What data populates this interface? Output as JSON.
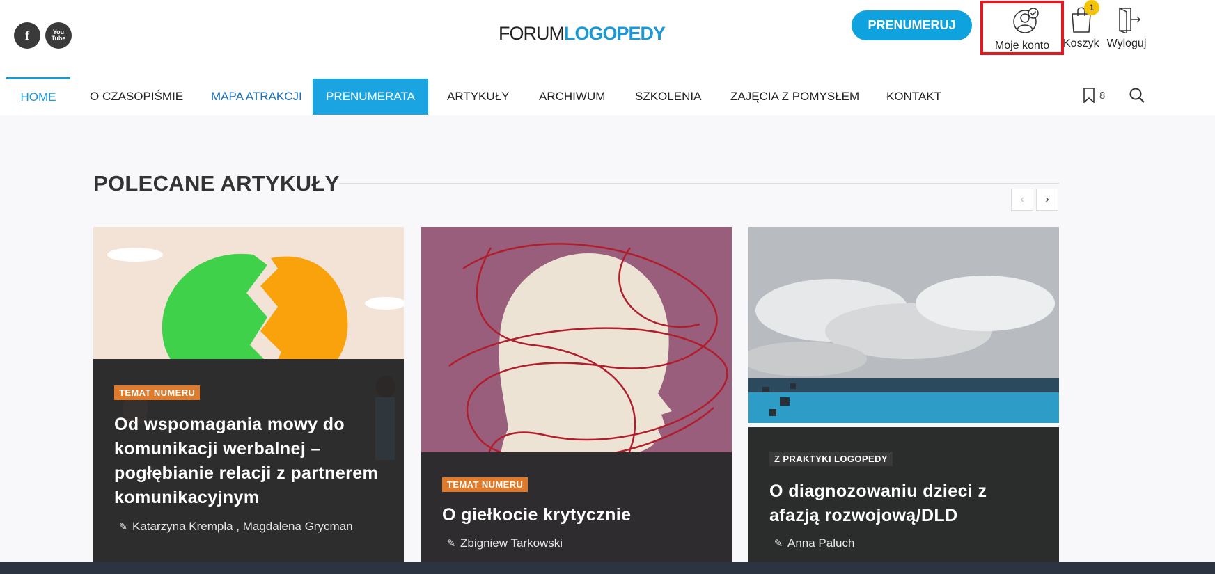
{
  "header": {
    "social": {
      "facebook": "f",
      "youtube": "You\nTube"
    },
    "logo": {
      "part_a": "FORUM",
      "part_b": "LOGOPEDY"
    },
    "subscribe_label": "PRENUMERUJ",
    "account_label": "Moje konto",
    "cart_label": "Koszyk",
    "cart_count": "1",
    "logout_label": "Wyloguj"
  },
  "nav": {
    "items": [
      "HOME",
      "O CZASOPIŚMIE",
      "MAPA ATRAKCJI",
      "PRENUMERATA",
      "ARTYKUŁY",
      "ARCHIWUM",
      "SZKOLENIA",
      "ZAJĘCIA Z POMYSŁEM",
      "KONTAKT"
    ],
    "bookmark_count": "8"
  },
  "section": {
    "title": "POLECANE ARTYKUŁY",
    "prev": "‹",
    "next": "›"
  },
  "cards": [
    {
      "tag": "TEMAT NUMERU",
      "title": "Od wspomagania mowy do komunikacji werbalnej – pogłębianie relacji z partnerem komunikacyjnym",
      "author": "Katarzyna Krempla , Magdalena Grycman"
    },
    {
      "tag": "TEMAT NUMERU",
      "title": "O giełkocie krytycznie",
      "author": "Zbigniew Tarkowski"
    },
    {
      "tag": "Z PRAKTYKI LOGOPEDY",
      "title": "O diagnozowaniu dzieci z afazją rozwojową/DLD",
      "author": "Anna Paluch"
    }
  ],
  "colors": {
    "accent": "#1a98d5",
    "highlight_box": "#e11a22",
    "badge": "#f7c300",
    "tag_orange": "#e07a2b"
  },
  "icons": [
    "facebook-icon",
    "youtube-icon",
    "account-icon",
    "cart-icon",
    "logout-icon",
    "bookmark-icon",
    "search-icon",
    "pen-icon"
  ]
}
